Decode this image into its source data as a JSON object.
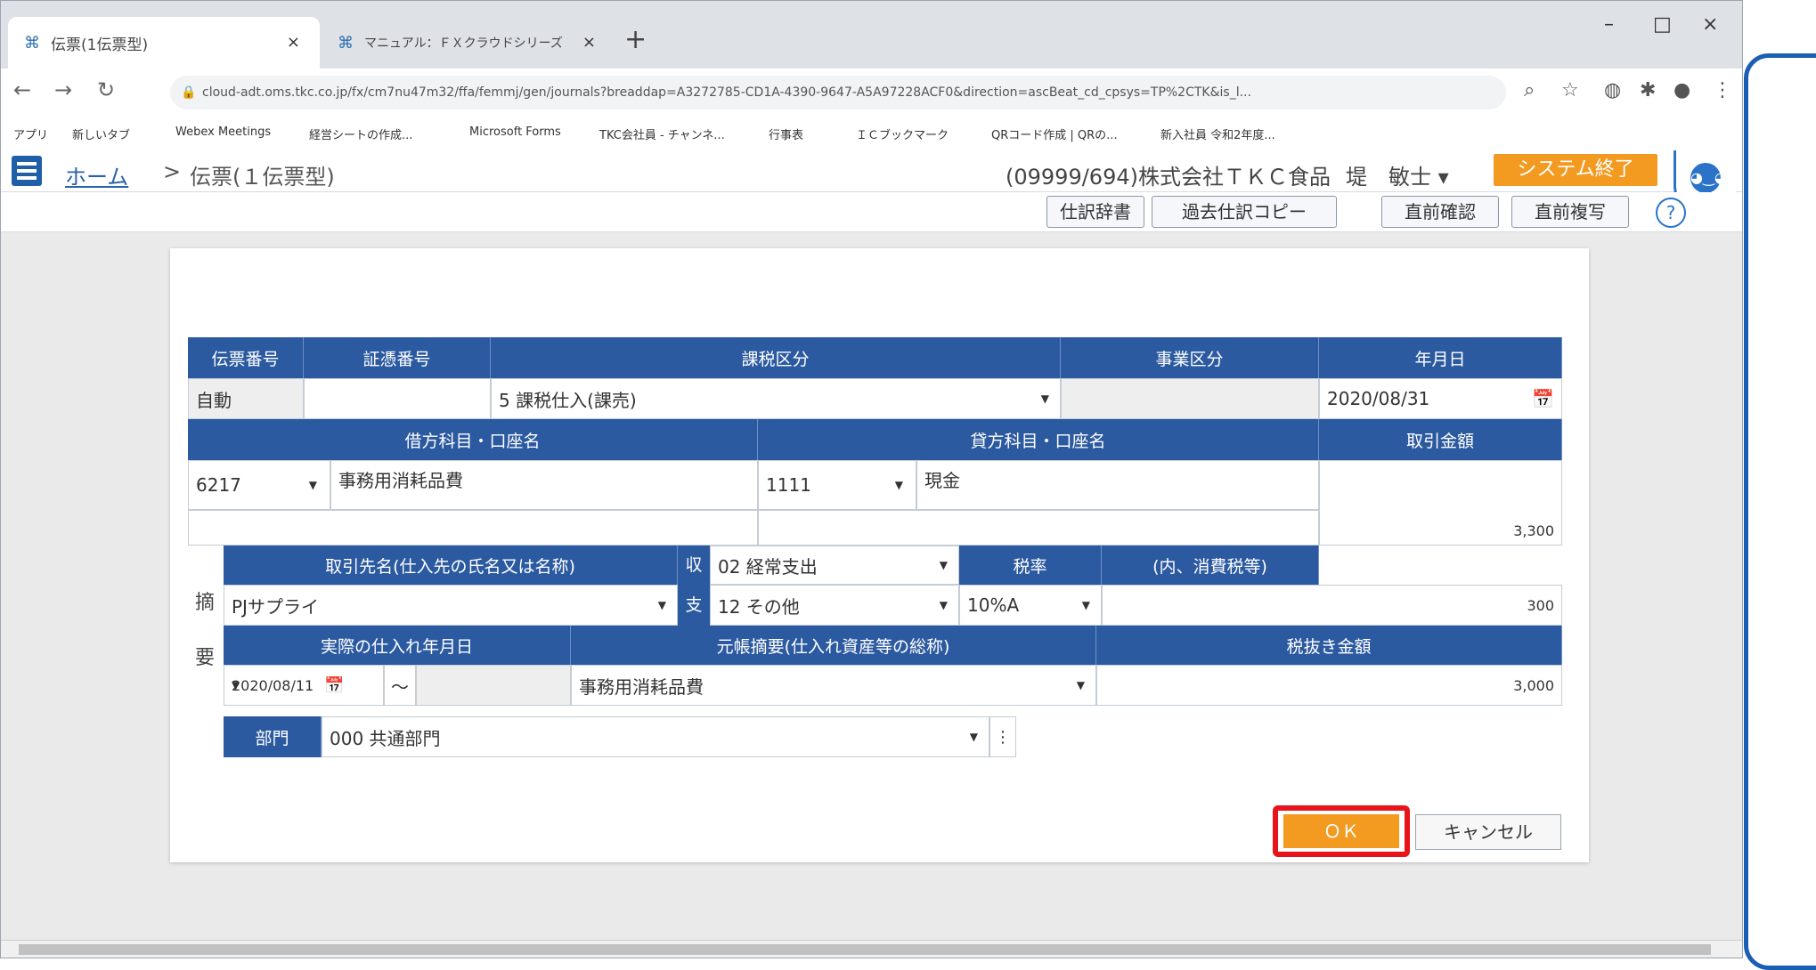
{
  "browser": {
    "tabs": [
      {
        "label": "伝票(1伝票型)",
        "active": true
      },
      {
        "label": "マニュアル：ＦＸクラウドシリーズ",
        "active": false
      }
    ],
    "new_tab": "+",
    "controls": {
      "minimize": "–",
      "maximize": "□",
      "close": "×"
    },
    "url": "cloud-adt.oms.tkc.co.jp/fx/cm7nu47m32/ffa/femmj/gen/journals?breaddap=A3272785-CD1A-4390-9647-A5A97228ACF0&direction=ascBeat_cd_cpsys=TP%2CTK&is_l...",
    "bookmarks": [
      "アプリ",
      "新しいタブ",
      "Webex Meetings",
      "経営シートの作成...",
      "Microsoft Forms",
      "TKC会社員 - チャンネ...",
      "行事表",
      "ＩＣブックマーク",
      "QRコード作成 | QRの...",
      "新入社員 令和2年度..."
    ]
  },
  "app": {
    "breadcrumb": {
      "home": "ホーム",
      "sep": ">",
      "page": "伝票(１伝票型)"
    },
    "company": "(09999/694)株式会社ＴＫＣ食品",
    "user": "堤　敏士 ▾",
    "end_button": "システム終了",
    "toolbar": {
      "dict": "仕訳辞書",
      "past_copy": "過去仕訳コピー",
      "prev_check": "直前確認",
      "prev_copy": "直前複写",
      "help": "?"
    }
  },
  "form": {
    "headers1": {
      "voucher_no": "伝票番号",
      "evidence_no": "証憑番号",
      "tax_class": "課税区分",
      "business_class": "事業区分",
      "date": "年月日"
    },
    "row1": {
      "voucher_no": "自動",
      "evidence_no": "",
      "tax_class": "5 課税仕入(課売)",
      "business_class": "",
      "date": "2020/08/31"
    },
    "headers2": {
      "debit": "借方科目・口座名",
      "credit": "貸方科目・口座名",
      "amount": "取引金額"
    },
    "row2": {
      "debit_code": "6217",
      "debit_name": "事務用消耗品費",
      "credit_code": "1111",
      "credit_name": "現金",
      "amount": "3,300"
    },
    "tekiyo_label": [
      "摘",
      "要"
    ],
    "partner": {
      "header": "取引先名(仕入先の氏名又は名称)",
      "value": "PJサプライ"
    },
    "shushi": {
      "label_top": "収",
      "label_bottom": "支",
      "income": "02 経常支出",
      "expense": "12 その他"
    },
    "tax_rate": {
      "header": "税率",
      "value": "10%A"
    },
    "consumption_tax": {
      "header": "(内、消費税等)",
      "value": "300"
    },
    "actual_date": {
      "header": "実際の仕入れ年月日",
      "from": "2020/08/11",
      "tilde": "～",
      "to": ""
    },
    "ledger_summary": {
      "header": "元帳摘要(仕入れ資産等の総称)",
      "value": "事務用消耗品費"
    },
    "pretax": {
      "header": "税抜き金額",
      "value": "3,000"
    },
    "department": {
      "label": "部門",
      "value": "000 共通部門"
    },
    "ok": "ＯＫ",
    "cancel": "キャンセル"
  }
}
